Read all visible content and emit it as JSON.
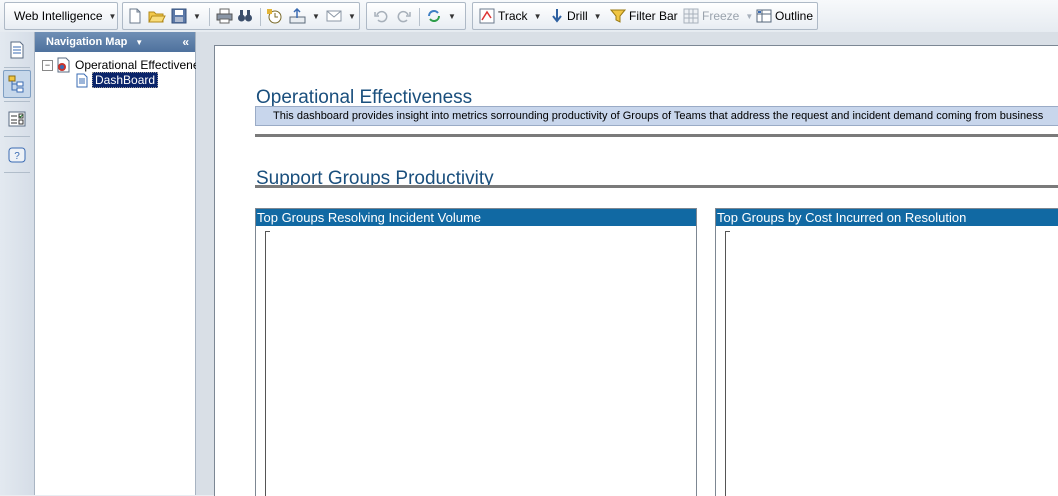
{
  "toolbar": {
    "app_menu": "Web Intelligence",
    "track": "Track",
    "drill": "Drill",
    "filter_bar": "Filter Bar",
    "freeze": "Freeze",
    "outline": "Outline"
  },
  "nav": {
    "header": "Navigation Map",
    "root": "Operational Effectiveness",
    "child": "DashBoard"
  },
  "report": {
    "title": "Operational Effectiveness",
    "description": "This dashboard provides insight into metrics sorrounding productivity of Groups of Teams that address the request and incident demand coming from business",
    "section_title": "Support Groups Productivity",
    "block_left_title": "Top Groups Resolving Incident Volume",
    "block_right_title": "Top Groups by Cost Incurred on Resolution"
  },
  "colors": {
    "accent_header": "#1169a3",
    "title_blue": "#1a4f7d",
    "desc_bg": "#c8d6ec"
  }
}
